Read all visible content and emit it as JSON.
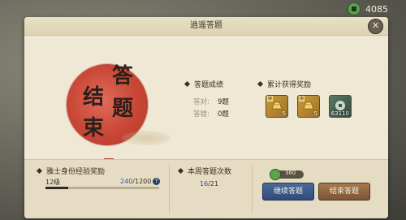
{
  "currency": {
    "icon": "jade-coin-icon",
    "amount": "4085"
  },
  "dialog": {
    "title": "逍遥答题",
    "close_label": "✕",
    "seal": {
      "chars": [
        "答",
        "结",
        "题",
        "束"
      ]
    },
    "results": {
      "heading": "答题成绩",
      "correct_label": "答对:",
      "correct_value": "9题",
      "wrong_label": "答错:",
      "wrong_value": "0题"
    },
    "rewards": {
      "heading": "累计获得奖励",
      "items": [
        {
          "icon": "gold-ingot-icon",
          "tag": "绑",
          "count": "5"
        },
        {
          "icon": "gold-ingot-icon",
          "tag": "绑",
          "count": "5"
        },
        {
          "icon": "silver-coin-icon",
          "tag": "",
          "count": "63110"
        }
      ]
    },
    "exp": {
      "heading": "雅士身份经验奖励",
      "level": "12级",
      "current": "240",
      "max": "/1200",
      "progress": 0.2,
      "help": "?"
    },
    "week": {
      "heading": "本周答题次数",
      "current": "16",
      "max": "/21"
    },
    "cost": {
      "icon": "jade-coin-icon",
      "value": "360"
    },
    "buttons": {
      "continue": "继续答题",
      "finish": "结束答题"
    }
  }
}
